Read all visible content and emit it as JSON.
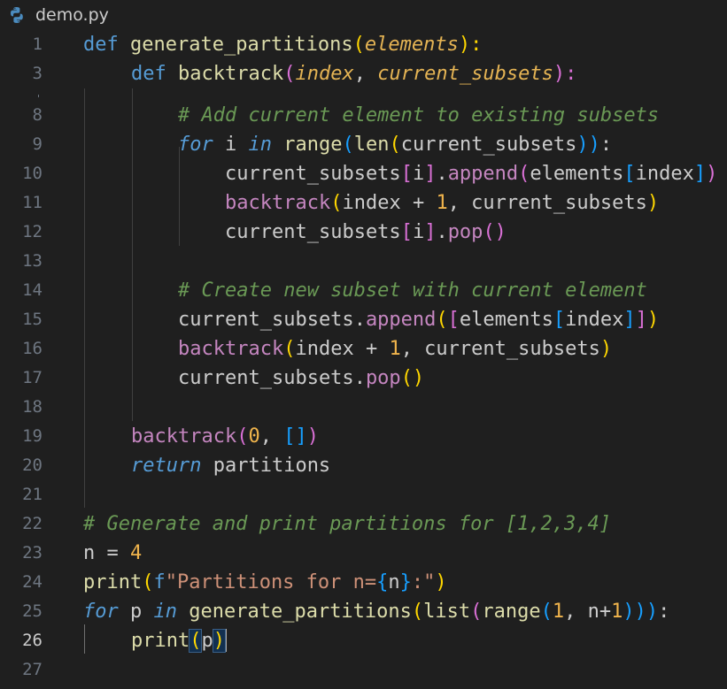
{
  "tab": {
    "file_name": "demo.py",
    "icon": "python-icon"
  },
  "editor": {
    "active_line": 26,
    "lines": [
      {
        "n": "1"
      },
      {
        "n": "3"
      },
      {
        "n": "8"
      },
      {
        "n": "9"
      },
      {
        "n": "10"
      },
      {
        "n": "11"
      },
      {
        "n": "12"
      },
      {
        "n": "13"
      },
      {
        "n": "14"
      },
      {
        "n": "15"
      },
      {
        "n": "16"
      },
      {
        "n": "17"
      },
      {
        "n": "18"
      },
      {
        "n": "19"
      },
      {
        "n": "20"
      },
      {
        "n": "21"
      },
      {
        "n": "22"
      },
      {
        "n": "23"
      },
      {
        "n": "24"
      },
      {
        "n": "25"
      },
      {
        "n": "26"
      },
      {
        "n": "27"
      }
    ],
    "tokens": {
      "l1": [
        "def",
        " ",
        "generate_partitions",
        "(",
        "elements",
        "):"
      ],
      "l3": [
        "def",
        " ",
        "backtrack",
        "(",
        "index",
        ", ",
        "current_subsets",
        "):"
      ],
      "l8": [
        "# Add current element to existing subsets"
      ],
      "l9": [
        "for",
        " i ",
        "in",
        " ",
        "range",
        "(",
        "len",
        "(",
        "current_subsets",
        "))",
        ":"
      ],
      "l10": [
        "current_subsets",
        "[",
        "i",
        "]",
        ".",
        "append",
        "(",
        "elements",
        "[",
        "index",
        "]",
        ")"
      ],
      "l11": [
        "backtrack",
        "(",
        "index + ",
        "1",
        ", current_subsets",
        ")"
      ],
      "l12": [
        "current_subsets",
        "[",
        "i",
        "]",
        ".",
        "pop",
        "()"
      ],
      "l14": [
        "# Create new subset with current element"
      ],
      "l15": [
        "current_subsets",
        ".",
        "append",
        "(",
        "[",
        "elements",
        "[",
        "index",
        "]",
        "]",
        ")"
      ],
      "l16": [
        "backtrack",
        "(",
        "index + ",
        "1",
        ", current_subsets",
        ")"
      ],
      "l17": [
        "current_subsets",
        ".",
        "pop",
        "()"
      ],
      "l19": [
        "backtrack",
        "(",
        "0",
        ", ",
        "[]",
        ")"
      ],
      "l20": [
        "return",
        " partitions"
      ],
      "l22": [
        "# Generate and print partitions for [1,2,3,4]"
      ],
      "l23": [
        "n = ",
        "4"
      ],
      "l24": [
        "print",
        "(",
        "f",
        "\"Partitions for n=",
        "{",
        "n",
        "}",
        ":\"",
        ")"
      ],
      "l25": [
        "for",
        " p ",
        "in",
        " ",
        "generate_partitions",
        "(",
        "list",
        "(",
        "range",
        "(",
        "1",
        ", n+",
        "1",
        ")))",
        ":"
      ],
      "l26": [
        "print",
        "(",
        "p",
        ")"
      ]
    }
  }
}
